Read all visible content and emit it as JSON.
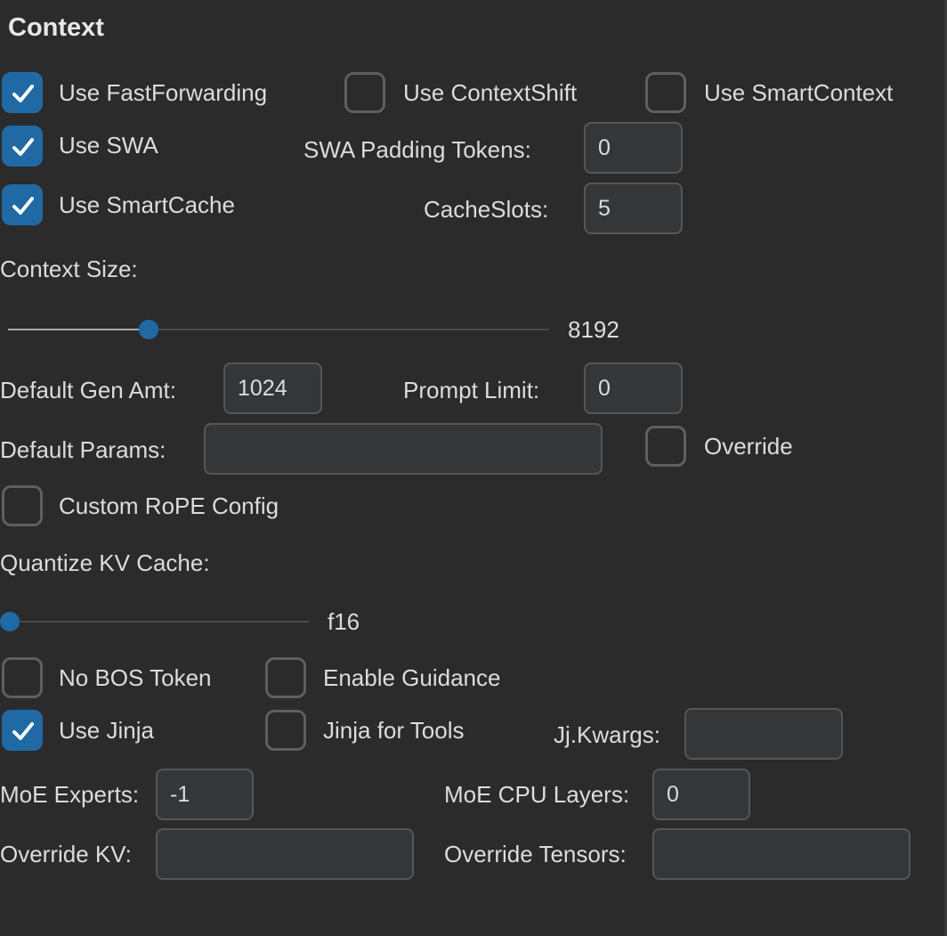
{
  "section": {
    "title": "Context"
  },
  "checkboxes": {
    "fast_forwarding": {
      "label": "Use FastForwarding",
      "checked": true
    },
    "context_shift": {
      "label": "Use ContextShift",
      "checked": false
    },
    "smart_context": {
      "label": "Use SmartContext",
      "checked": false
    },
    "swa": {
      "label": "Use SWA",
      "checked": true
    },
    "smart_cache": {
      "label": "Use SmartCache",
      "checked": true
    },
    "override": {
      "label": "Override",
      "checked": false
    },
    "custom_rope": {
      "label": "Custom RoPE Config",
      "checked": false
    },
    "no_bos": {
      "label": "No BOS Token",
      "checked": false
    },
    "enable_guidance": {
      "label": "Enable Guidance",
      "checked": false
    },
    "use_jinja": {
      "label": "Use Jinja",
      "checked": true
    },
    "jinja_tools": {
      "label": "Jinja for Tools",
      "checked": false
    }
  },
  "fields": {
    "swa_padding": {
      "label": "SWA Padding Tokens:",
      "value": "0"
    },
    "cache_slots": {
      "label": "CacheSlots:",
      "value": "5"
    },
    "default_gen_amt": {
      "label": "Default Gen Amt:",
      "value": "1024"
    },
    "prompt_limit": {
      "label": "Prompt Limit:",
      "value": "0"
    },
    "default_params": {
      "label": "Default Params:",
      "value": ""
    },
    "jj_kwargs": {
      "label": "Jj.Kwargs:",
      "value": ""
    },
    "moe_experts": {
      "label": "MoE Experts:",
      "value": "-1"
    },
    "moe_cpu_layers": {
      "label": "MoE CPU Layers:",
      "value": "0"
    },
    "override_kv": {
      "label": "Override KV:",
      "value": ""
    },
    "override_tensors": {
      "label": "Override Tensors:",
      "value": ""
    }
  },
  "sliders": {
    "context_size": {
      "label": "Context Size:",
      "value_text": "8192",
      "fraction": 0.26
    },
    "quantize_kv": {
      "label": "Quantize KV Cache:",
      "value_text": "f16",
      "fraction": 0.0
    }
  },
  "colors": {
    "background": "#2b2b2b",
    "accent": "#1f6aa5",
    "text": "#dcdcdc",
    "entry_bg": "#343638",
    "border": "#5f5f5f"
  }
}
